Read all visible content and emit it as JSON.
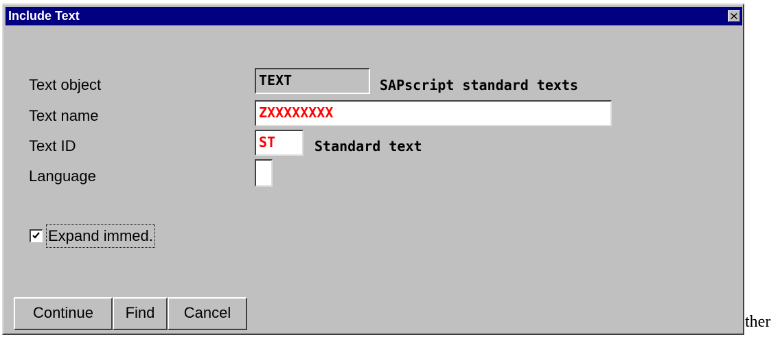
{
  "window": {
    "title": "Include Text",
    "close_icon": "close-icon"
  },
  "form": {
    "text_object": {
      "label": "Text object",
      "value": "TEXT",
      "description": "SAPscript standard texts"
    },
    "text_name": {
      "label": "Text name",
      "value": "ZXXXXXXXX"
    },
    "text_id": {
      "label": "Text ID",
      "value": "ST",
      "description": "Standard text"
    },
    "language": {
      "label": "Language",
      "value": ""
    },
    "expand_immediately": {
      "label": "Expand immed.",
      "checked": true
    }
  },
  "buttons": {
    "continue": "Continue",
    "find": "Find",
    "cancel": "Cancel"
  },
  "trailing_text": "ther",
  "colors": {
    "title_bar": "#000080",
    "dialog_bg": "#c0c0c0",
    "required_value_text": "#ff0000"
  }
}
